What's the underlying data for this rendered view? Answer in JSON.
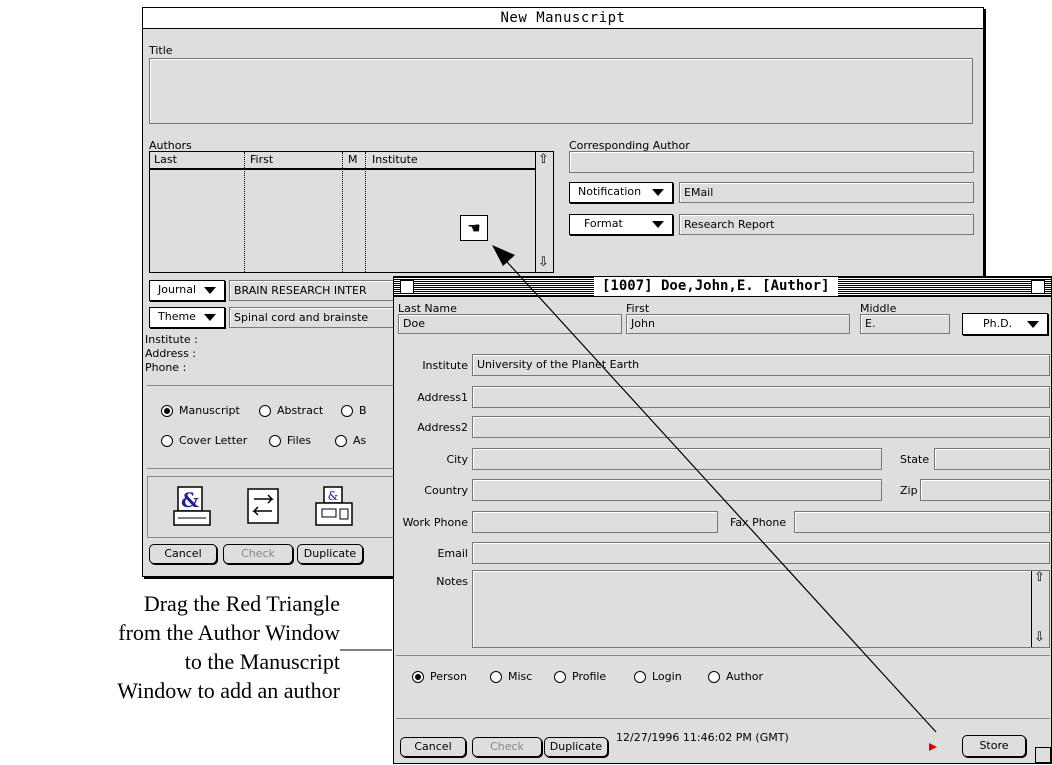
{
  "manuscript_window": {
    "title": "New Manuscript",
    "title_label": "Title",
    "authors_label": "Authors",
    "columns": [
      "Last",
      "First",
      "M",
      "Institute"
    ],
    "corresponding_author_label": "Corresponding Author",
    "notification_popup": "Notification",
    "notification_value": "EMail",
    "format_popup": "Format",
    "format_value": "Research Report",
    "journal_popup": "Journal",
    "journal_value": "BRAIN RESEARCH INTER",
    "theme_popup": "Theme",
    "theme_value": "Spinal cord and brainste",
    "institute_label": "Institute :",
    "address_label": "Address :",
    "phone_label": "Phone :",
    "radios_row1": [
      "Manuscript",
      "Abstract",
      "B"
    ],
    "radios_row2": [
      "Cover Letter",
      "Files",
      "As"
    ],
    "buttons": [
      "Cancel",
      "Check",
      "Duplicate"
    ]
  },
  "author_window": {
    "title": "[1007] Doe,John,E. [Author]",
    "last_name_label": "Last Name",
    "last_name_value": "Doe",
    "first_label": "First",
    "first_value": "John",
    "middle_label": "Middle",
    "middle_value": "E.",
    "degree_popup": "Ph.D.",
    "institute_label": "Institute",
    "institute_value": "University of the Planet Earth",
    "address1_label": "Address1",
    "address2_label": "Address2",
    "city_label": "City",
    "state_label": "State",
    "country_label": "Country",
    "zip_label": "Zip",
    "work_phone_label": "Work Phone",
    "fax_phone_label": "Fax Phone",
    "email_label": "Email",
    "notes_label": "Notes",
    "radios": [
      "Person",
      "Misc",
      "Profile",
      "Login",
      "Author"
    ],
    "buttons": [
      "Cancel",
      "Check",
      "Duplicate"
    ],
    "timestamp": "12/27/1996 11:46:02 PM (GMT)",
    "store_button": "Store"
  },
  "caption": {
    "line1": "Drag the Red Triangle",
    "line2": "from the Author Window",
    "line3": "to the Manuscript",
    "line4": "Window to add an author"
  },
  "colors": {
    "window_bg": "#dedede",
    "accent_red": "#e00000",
    "field_bg": "#dedede"
  }
}
